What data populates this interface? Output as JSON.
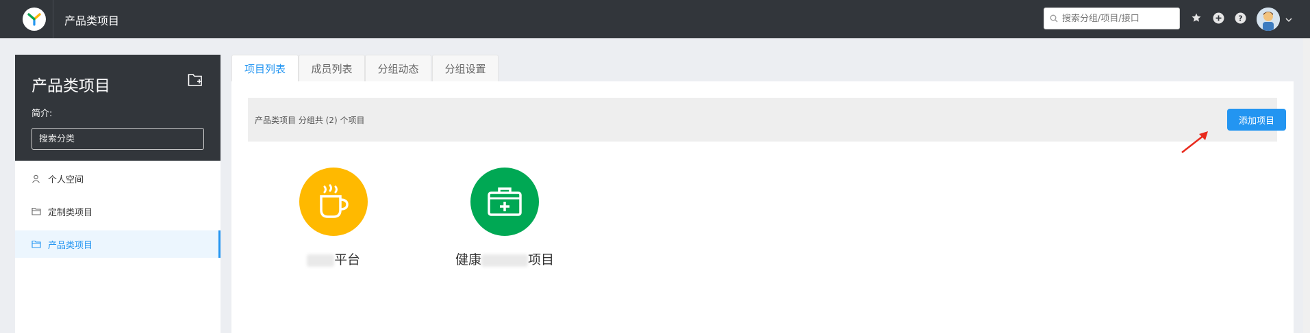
{
  "header": {
    "app_title": "产品类项目",
    "search_placeholder": "搜索分组/项目/接口",
    "icons": [
      "star-icon",
      "plus-circle-icon",
      "help-icon",
      "avatar",
      "chevron-down-icon"
    ]
  },
  "group_panel": {
    "title": "产品类项目",
    "intro_label": "简介:",
    "category_search_placeholder": "搜索分类"
  },
  "sidebar": {
    "items": [
      {
        "label": "个人空间",
        "icon": "user-icon",
        "active": false
      },
      {
        "label": "定制类项目",
        "icon": "folder-icon",
        "active": false
      },
      {
        "label": "产品类项目",
        "icon": "folder-icon",
        "active": true
      }
    ]
  },
  "tabs": [
    {
      "label": "项目列表",
      "active": true
    },
    {
      "label": "成员列表",
      "active": false
    },
    {
      "label": "分组动态",
      "active": false
    },
    {
      "label": "分组设置",
      "active": false
    }
  ],
  "main": {
    "summary_text": "产品类项目 分组共 (2) 个项目",
    "add_button_label": "添加项目",
    "projects": [
      {
        "name_visible": "平台",
        "icon": "coffee-cup-icon",
        "color": "#ffb900"
      },
      {
        "name_prefix": "健康",
        "name_suffix": "项目",
        "icon": "medical-kit-icon",
        "color": "#00a854"
      }
    ]
  },
  "colors": {
    "topbar": "#32363b",
    "accent": "#2395f1",
    "arrow": "#e8291c"
  }
}
